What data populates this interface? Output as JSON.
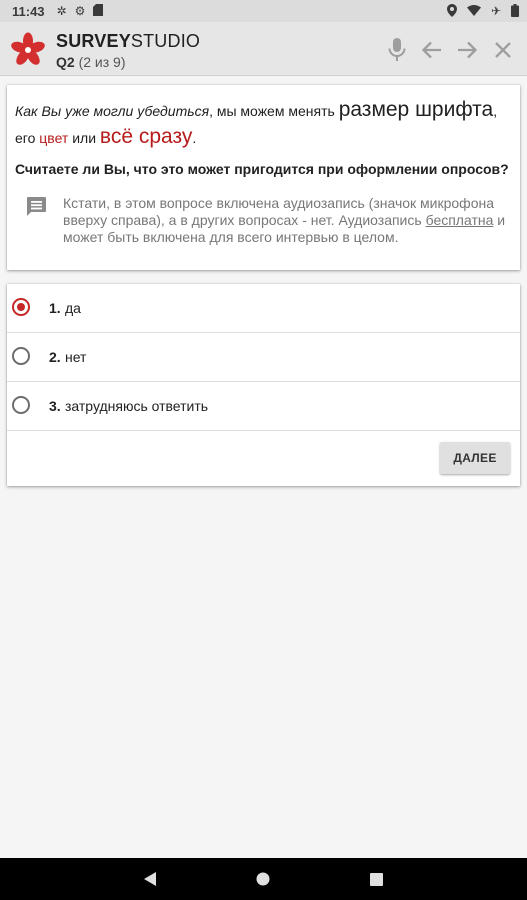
{
  "status_bar": {
    "time": "11:43",
    "left_icons": [
      "pinwheel-icon",
      "gear-icon",
      "sd-card-icon"
    ],
    "right_icons": [
      "location-icon",
      "wifi-icon",
      "airplane-icon",
      "battery-icon"
    ]
  },
  "app_bar": {
    "title_bold": "SURVEY",
    "title_rest": "STUDIO",
    "question_id": "Q2",
    "progress": "(2 из 9)",
    "actions": [
      "microphone-icon",
      "back-arrow-icon",
      "forward-arrow-icon",
      "close-icon"
    ]
  },
  "question": {
    "intro_italic": "Как Вы уже могли убедиться",
    "intro_part1": ", мы можем менять ",
    "intro_big": "размер шрифта",
    "intro_part2": ",",
    "intro_part3": "его ",
    "intro_red": "цвет",
    "intro_part4": " или ",
    "intro_redbig": "всё сразу",
    "intro_part5": ".",
    "text": "Считаете ли Вы, что это может пригодится при оформлении опросов?",
    "hint_part1": "Кстати, в этом вопросе включена аудиозапись (значок микрофона вверху справа), а в других вопросах - нет. Аудиозапись ",
    "hint_underlined": "бесплатна",
    "hint_part2": " и может быть включена для всего интервью в целом."
  },
  "answers": [
    {
      "num": "1.",
      "label": "да",
      "selected": true
    },
    {
      "num": "2.",
      "label": "нет",
      "selected": false
    },
    {
      "num": "3.",
      "label": "затрудняюсь ответить",
      "selected": false
    }
  ],
  "next_button": "ДАЛЕЕ",
  "colors": {
    "accent": "#c62828",
    "text_red": "#b71c1c",
    "app_bar": "#e6e6e6",
    "nav_bar": "#000000"
  }
}
